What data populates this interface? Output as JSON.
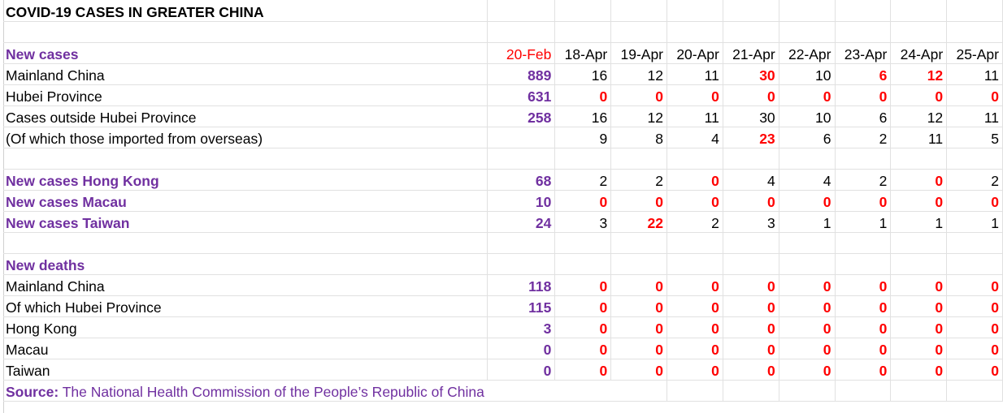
{
  "title": "COVID-19 CASES IN GREATER CHINA",
  "dates": [
    "20-Feb",
    "18-Apr",
    "19-Apr",
    "20-Apr",
    "21-Apr",
    "22-Apr",
    "23-Apr",
    "24-Apr",
    "25-Apr"
  ],
  "new_cases_header": "New cases",
  "new_cases": [
    {
      "label": "Mainland China",
      "values": [
        "889",
        "16",
        "12",
        "11",
        "30",
        "10",
        "6",
        "12",
        "11"
      ]
    },
    {
      "label": "Hubei Province",
      "values": [
        "631",
        "0",
        "0",
        "0",
        "0",
        "0",
        "0",
        "0",
        "0"
      ]
    },
    {
      "label": "Cases outside Hubei Province",
      "values": [
        "258",
        "16",
        "12",
        "11",
        "30",
        "10",
        "6",
        "12",
        "11"
      ]
    },
    {
      "label": "(Of which those imported from overseas)",
      "values": [
        "",
        "9",
        "8",
        "4",
        "23",
        "6",
        "2",
        "11",
        "5"
      ]
    }
  ],
  "regional_cases": [
    {
      "label": "New cases Hong Kong",
      "values": [
        "68",
        "2",
        "2",
        "0",
        "4",
        "4",
        "2",
        "0",
        "2"
      ]
    },
    {
      "label": "New cases Macau",
      "values": [
        "10",
        "0",
        "0",
        "0",
        "0",
        "0",
        "0",
        "0",
        "0"
      ]
    },
    {
      "label": "New cases Taiwan",
      "values": [
        "24",
        "3",
        "22",
        "2",
        "3",
        "1",
        "1",
        "1",
        "1"
      ]
    }
  ],
  "new_deaths_header": "New deaths",
  "new_deaths": [
    {
      "label": "Mainland China",
      "values": [
        "118",
        "0",
        "0",
        "0",
        "0",
        "0",
        "0",
        "0",
        "0"
      ]
    },
    {
      "label": "Of which Hubei Province",
      "values": [
        "115",
        "0",
        "0",
        "0",
        "0",
        "0",
        "0",
        "0",
        "0"
      ]
    },
    {
      "label": "Hong Kong",
      "values": [
        "3",
        "0",
        "0",
        "0",
        "0",
        "0",
        "0",
        "0",
        "0"
      ]
    },
    {
      "label": "Macau",
      "values": [
        "0",
        "0",
        "0",
        "0",
        "0",
        "0",
        "0",
        "0",
        "0"
      ]
    },
    {
      "label": "Taiwan",
      "values": [
        "0",
        "0",
        "0",
        "0",
        "0",
        "0",
        "0",
        "0",
        "0"
      ]
    }
  ],
  "source_label": "Source:",
  "source_text": " The National Health Commission of the People’s Republic of China",
  "colors": {
    "purple": "#7030a0",
    "red": "#ff0000",
    "gridline": "#e1e1e1"
  }
}
